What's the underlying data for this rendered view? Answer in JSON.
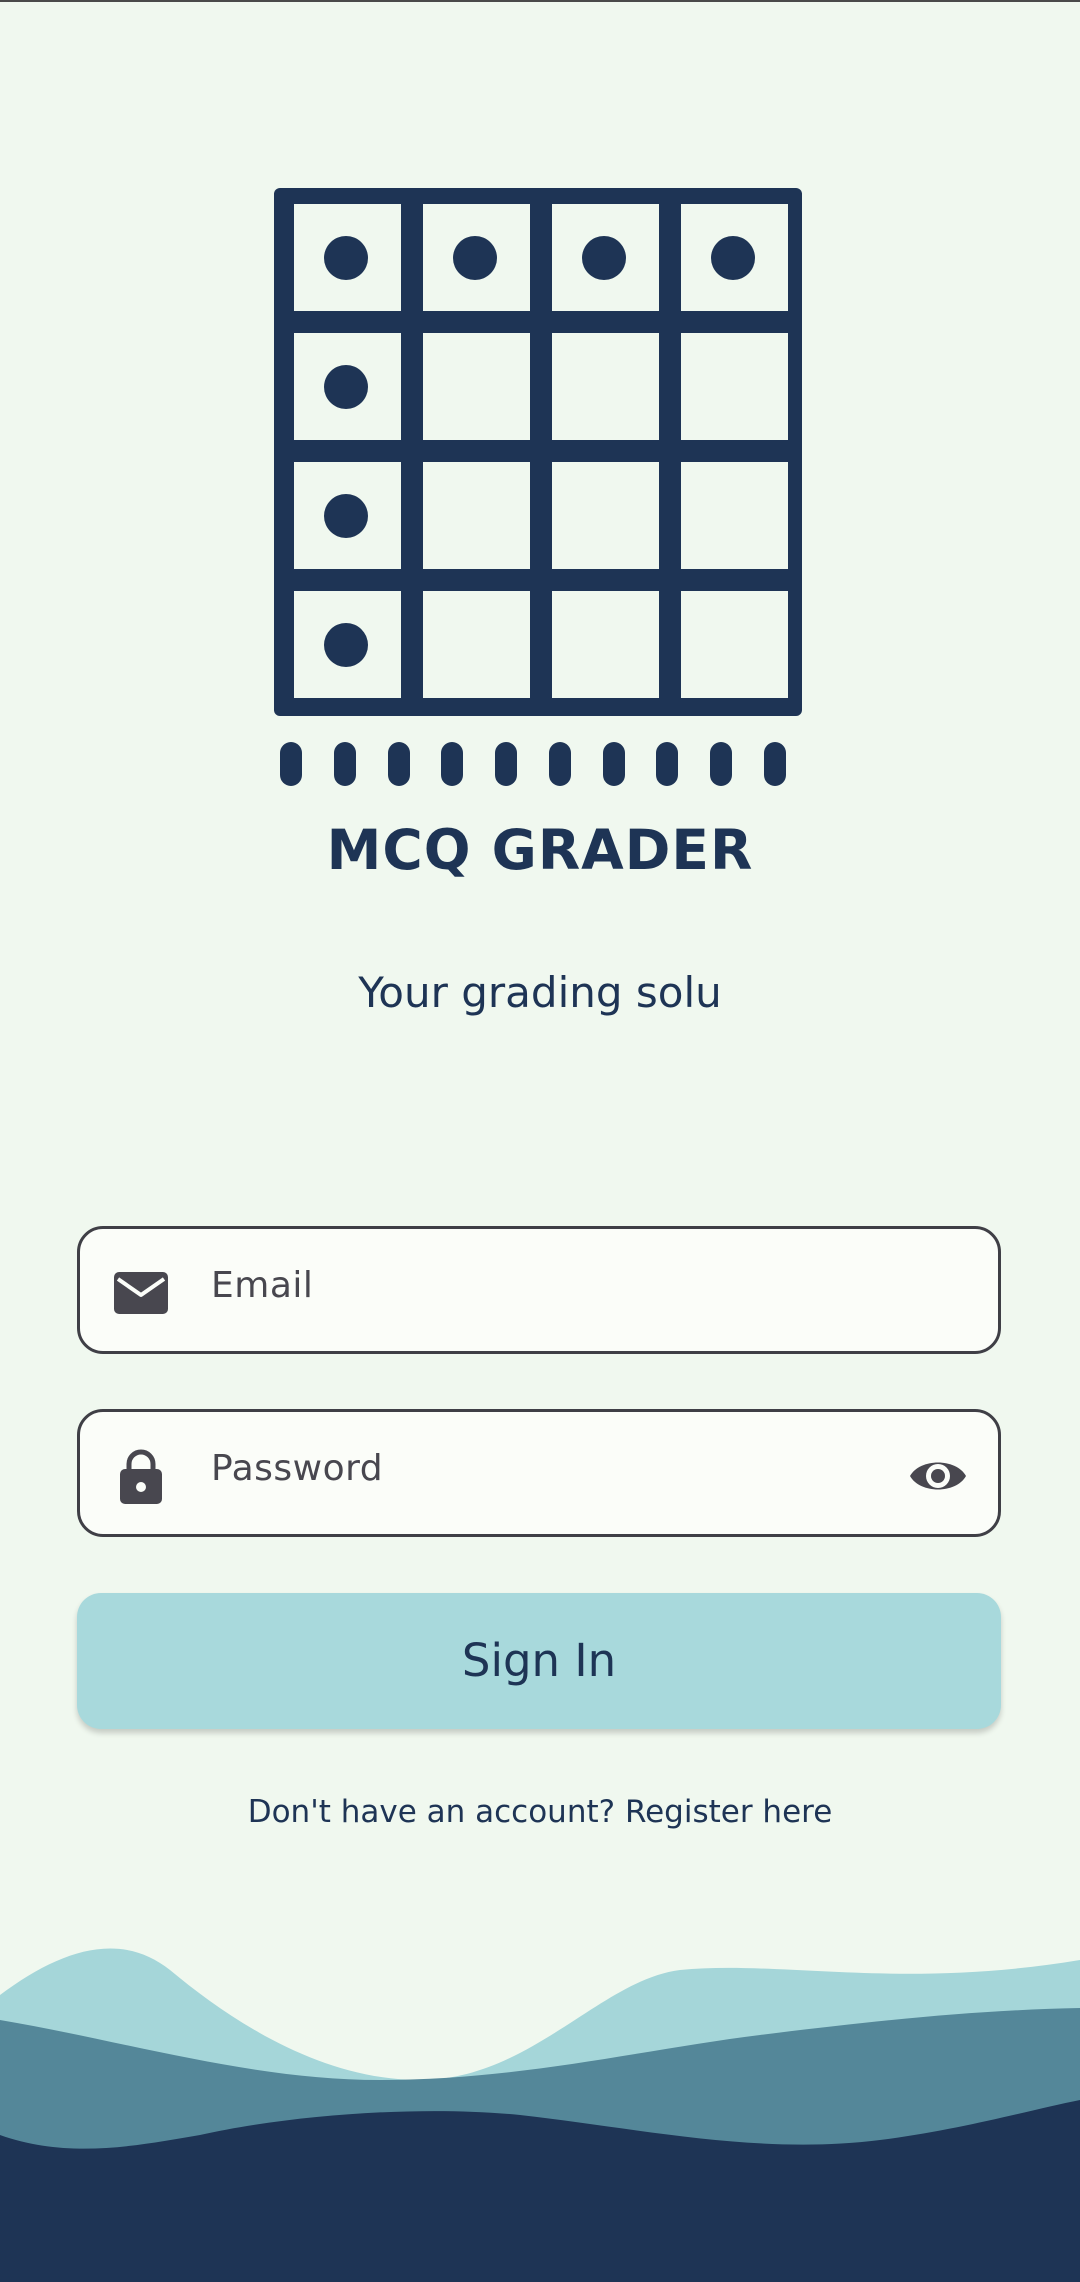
{
  "app": {
    "title": "MCQ GRADER",
    "tagline": "Your grading solu"
  },
  "form": {
    "email_placeholder": "Email",
    "password_placeholder": "Password",
    "signin_label": "Sign In",
    "register_link": "Don't have an account? Register here"
  },
  "icons": {
    "logo": "answer-grid-logo",
    "email": "mail-icon",
    "password": "lock-icon",
    "toggle_visibility": "eye-icon"
  },
  "colors": {
    "background": "#f0f8ef",
    "primary_navy": "#1e3455",
    "button": "#a8d9dc",
    "wave_light": "#a5d6d9",
    "wave_mid": "#548799",
    "wave_dark": "#1e3455"
  }
}
